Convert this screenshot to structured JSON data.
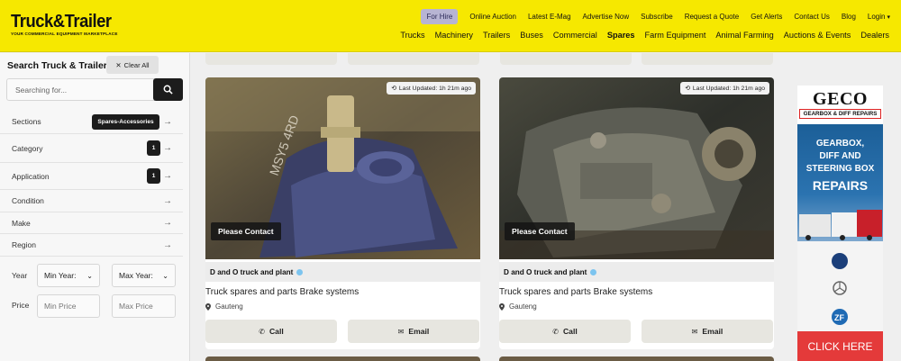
{
  "header": {
    "logo": "Truck&Trailer",
    "logo_tagline": "YOUR COMMERCIAL EQUIPMENT MARKETPLACE",
    "top_links": [
      "For Hire",
      "Online Auction",
      "Latest E-Mag",
      "Advertise Now",
      "Subscribe",
      "Request a Quote",
      "Get Alerts",
      "Contact Us",
      "Blog",
      "Login"
    ],
    "main_nav": [
      "Trucks",
      "Machinery",
      "Trailers",
      "Buses",
      "Commercial",
      "Spares",
      "Farm Equipment",
      "Animal Farming",
      "Auctions & Events",
      "Dealers"
    ],
    "active_nav": "Spares"
  },
  "sidebar": {
    "title": "Search Truck & Trailer",
    "clear_all": "Clear All",
    "search_placeholder": "Searching for...",
    "filters": [
      {
        "label": "Sections",
        "badge": "Spares-Accessories"
      },
      {
        "label": "Category",
        "badge": "1"
      },
      {
        "label": "Application",
        "badge": "1"
      },
      {
        "label": "Condition"
      },
      {
        "label": "Make"
      },
      {
        "label": "Region"
      }
    ],
    "year": {
      "label": "Year",
      "min": "Min Year:",
      "max": "Max Year:"
    },
    "price": {
      "label": "Price",
      "min_placeholder": "Min Price",
      "max_placeholder": "Max Price"
    }
  },
  "listings": [
    {
      "updated": "Last Updated: 1h 21m ago",
      "overlay": "Please Contact",
      "dealer": "D and O truck and plant",
      "title": "Truck spares and parts Brake systems",
      "location": "Gauteng",
      "call": "Call",
      "email": "Email"
    },
    {
      "updated": "Last Updated: 1h 21m ago",
      "overlay": "Please Contact",
      "dealer": "D and O truck and plant",
      "title": "Truck spares and parts Brake systems",
      "location": "Gauteng",
      "call": "Call",
      "email": "Email"
    }
  ],
  "ad": {
    "brand": "GECO",
    "subtitle": "GEARBOX & DIFF REPAIRS",
    "lines": [
      "GEARBOX,",
      "DIFF AND",
      "STEERING BOX"
    ],
    "headline": "REPAIRS",
    "cta": "CLICK HERE"
  },
  "colors": {
    "header_bg": "#f6e800",
    "for_hire_bg": "#b7b4d3",
    "dark": "#1c1c1c",
    "button_bg": "#e7e6e0",
    "ad_red": "#e43a3a",
    "ad_blue": "#1c5f98"
  }
}
